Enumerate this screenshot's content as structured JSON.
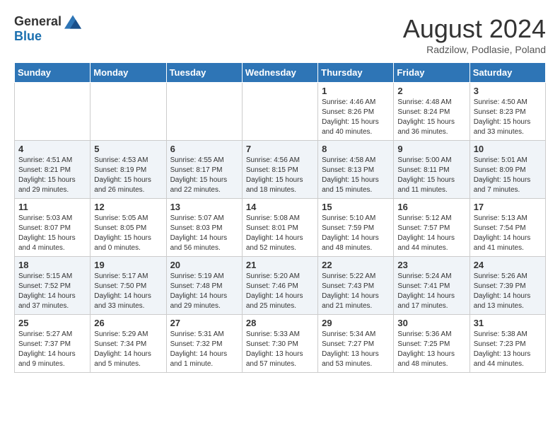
{
  "header": {
    "logo_general": "General",
    "logo_blue": "Blue",
    "month_title": "August 2024",
    "subtitle": "Radzilow, Podlasie, Poland"
  },
  "weekdays": [
    "Sunday",
    "Monday",
    "Tuesday",
    "Wednesday",
    "Thursday",
    "Friday",
    "Saturday"
  ],
  "weeks": [
    [
      {
        "day": "",
        "info": ""
      },
      {
        "day": "",
        "info": ""
      },
      {
        "day": "",
        "info": ""
      },
      {
        "day": "",
        "info": ""
      },
      {
        "day": "1",
        "info": "Sunrise: 4:46 AM\nSunset: 8:26 PM\nDaylight: 15 hours\nand 40 minutes."
      },
      {
        "day": "2",
        "info": "Sunrise: 4:48 AM\nSunset: 8:24 PM\nDaylight: 15 hours\nand 36 minutes."
      },
      {
        "day": "3",
        "info": "Sunrise: 4:50 AM\nSunset: 8:23 PM\nDaylight: 15 hours\nand 33 minutes."
      }
    ],
    [
      {
        "day": "4",
        "info": "Sunrise: 4:51 AM\nSunset: 8:21 PM\nDaylight: 15 hours\nand 29 minutes."
      },
      {
        "day": "5",
        "info": "Sunrise: 4:53 AM\nSunset: 8:19 PM\nDaylight: 15 hours\nand 26 minutes."
      },
      {
        "day": "6",
        "info": "Sunrise: 4:55 AM\nSunset: 8:17 PM\nDaylight: 15 hours\nand 22 minutes."
      },
      {
        "day": "7",
        "info": "Sunrise: 4:56 AM\nSunset: 8:15 PM\nDaylight: 15 hours\nand 18 minutes."
      },
      {
        "day": "8",
        "info": "Sunrise: 4:58 AM\nSunset: 8:13 PM\nDaylight: 15 hours\nand 15 minutes."
      },
      {
        "day": "9",
        "info": "Sunrise: 5:00 AM\nSunset: 8:11 PM\nDaylight: 15 hours\nand 11 minutes."
      },
      {
        "day": "10",
        "info": "Sunrise: 5:01 AM\nSunset: 8:09 PM\nDaylight: 15 hours\nand 7 minutes."
      }
    ],
    [
      {
        "day": "11",
        "info": "Sunrise: 5:03 AM\nSunset: 8:07 PM\nDaylight: 15 hours\nand 4 minutes."
      },
      {
        "day": "12",
        "info": "Sunrise: 5:05 AM\nSunset: 8:05 PM\nDaylight: 15 hours\nand 0 minutes."
      },
      {
        "day": "13",
        "info": "Sunrise: 5:07 AM\nSunset: 8:03 PM\nDaylight: 14 hours\nand 56 minutes."
      },
      {
        "day": "14",
        "info": "Sunrise: 5:08 AM\nSunset: 8:01 PM\nDaylight: 14 hours\nand 52 minutes."
      },
      {
        "day": "15",
        "info": "Sunrise: 5:10 AM\nSunset: 7:59 PM\nDaylight: 14 hours\nand 48 minutes."
      },
      {
        "day": "16",
        "info": "Sunrise: 5:12 AM\nSunset: 7:57 PM\nDaylight: 14 hours\nand 44 minutes."
      },
      {
        "day": "17",
        "info": "Sunrise: 5:13 AM\nSunset: 7:54 PM\nDaylight: 14 hours\nand 41 minutes."
      }
    ],
    [
      {
        "day": "18",
        "info": "Sunrise: 5:15 AM\nSunset: 7:52 PM\nDaylight: 14 hours\nand 37 minutes."
      },
      {
        "day": "19",
        "info": "Sunrise: 5:17 AM\nSunset: 7:50 PM\nDaylight: 14 hours\nand 33 minutes."
      },
      {
        "day": "20",
        "info": "Sunrise: 5:19 AM\nSunset: 7:48 PM\nDaylight: 14 hours\nand 29 minutes."
      },
      {
        "day": "21",
        "info": "Sunrise: 5:20 AM\nSunset: 7:46 PM\nDaylight: 14 hours\nand 25 minutes."
      },
      {
        "day": "22",
        "info": "Sunrise: 5:22 AM\nSunset: 7:43 PM\nDaylight: 14 hours\nand 21 minutes."
      },
      {
        "day": "23",
        "info": "Sunrise: 5:24 AM\nSunset: 7:41 PM\nDaylight: 14 hours\nand 17 minutes."
      },
      {
        "day": "24",
        "info": "Sunrise: 5:26 AM\nSunset: 7:39 PM\nDaylight: 14 hours\nand 13 minutes."
      }
    ],
    [
      {
        "day": "25",
        "info": "Sunrise: 5:27 AM\nSunset: 7:37 PM\nDaylight: 14 hours\nand 9 minutes."
      },
      {
        "day": "26",
        "info": "Sunrise: 5:29 AM\nSunset: 7:34 PM\nDaylight: 14 hours\nand 5 minutes."
      },
      {
        "day": "27",
        "info": "Sunrise: 5:31 AM\nSunset: 7:32 PM\nDaylight: 14 hours\nand 1 minute."
      },
      {
        "day": "28",
        "info": "Sunrise: 5:33 AM\nSunset: 7:30 PM\nDaylight: 13 hours\nand 57 minutes."
      },
      {
        "day": "29",
        "info": "Sunrise: 5:34 AM\nSunset: 7:27 PM\nDaylight: 13 hours\nand 53 minutes."
      },
      {
        "day": "30",
        "info": "Sunrise: 5:36 AM\nSunset: 7:25 PM\nDaylight: 13 hours\nand 48 minutes."
      },
      {
        "day": "31",
        "info": "Sunrise: 5:38 AM\nSunset: 7:23 PM\nDaylight: 13 hours\nand 44 minutes."
      }
    ]
  ]
}
